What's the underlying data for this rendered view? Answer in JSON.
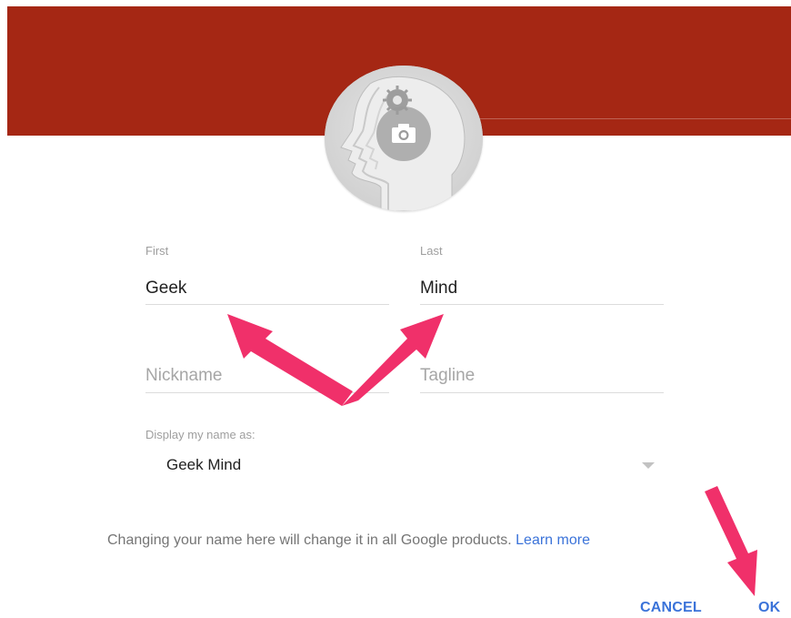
{
  "profile": {
    "header_color": "#a52714",
    "avatar": {
      "icon": "camera-icon",
      "placeholder_icon": "head-silhouette-icon"
    }
  },
  "form": {
    "first": {
      "label": "First",
      "value": "Geek"
    },
    "last": {
      "label": "Last",
      "value": "Mind"
    },
    "nickname": {
      "placeholder": "Nickname",
      "value": ""
    },
    "tagline": {
      "placeholder": "Tagline",
      "value": ""
    },
    "display_as": {
      "label": "Display my name as:",
      "selected": "Geek Mind"
    }
  },
  "info": {
    "text": "Changing your name here will change it in all Google products.",
    "link": "Learn more"
  },
  "actions": {
    "cancel": "CANCEL",
    "ok": "OK"
  },
  "colors": {
    "accent": "#3b73d9",
    "annotation_arrow": "#f0306a"
  }
}
